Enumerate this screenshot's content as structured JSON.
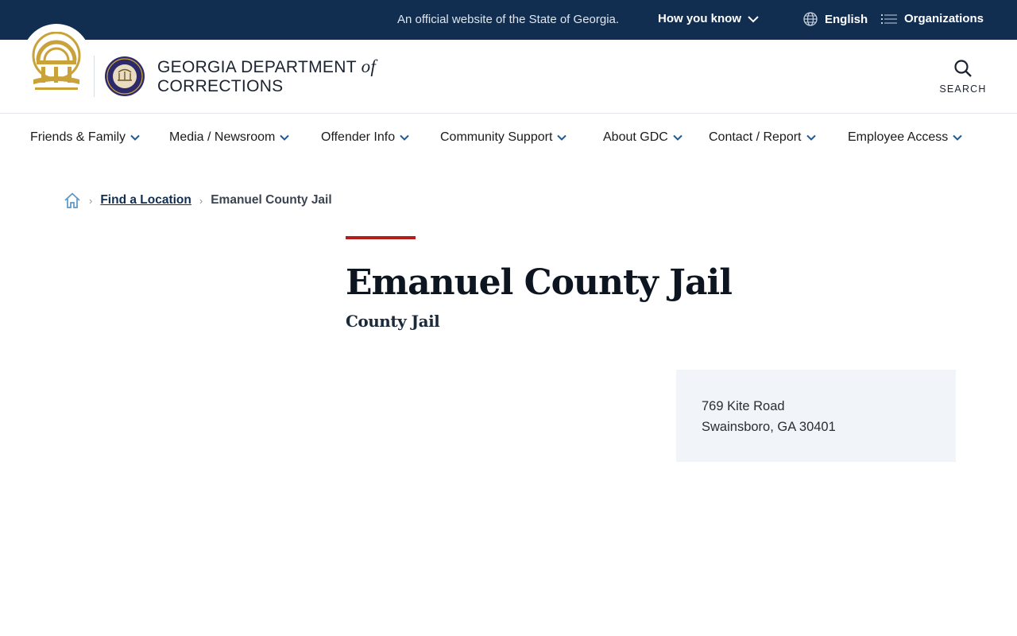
{
  "gov_banner": {
    "official_text": "An official website of the State of Georgia.",
    "how_you_know": "How you know",
    "language": "English",
    "organizations": "Organizations"
  },
  "header": {
    "title_line1_a": "GEORGIA DEPARTMENT ",
    "title_of": "of",
    "title_line2": "CORRECTIONS",
    "search_label": "SEARCH"
  },
  "nav": {
    "items": [
      {
        "label": "Friends & Family"
      },
      {
        "label": "Media / Newsroom"
      },
      {
        "label": "Offender Info"
      },
      {
        "label": "Community Support"
      },
      {
        "label": "About GDC"
      },
      {
        "label": "Contact / Report"
      },
      {
        "label": "Employee Access"
      }
    ]
  },
  "breadcrumb": {
    "link": "Find a Location",
    "current": "Emanuel County Jail"
  },
  "page": {
    "title": "Emanuel County Jail",
    "subtitle": "County Jail"
  },
  "address": {
    "line1": "769 Kite Road",
    "line2": "Swainsboro, GA 30401"
  },
  "colors": {
    "banner": "#112e51",
    "accent": "#b51c1c",
    "seal_gold": "#c9a23a",
    "seal_navy": "#2c2a6b"
  }
}
